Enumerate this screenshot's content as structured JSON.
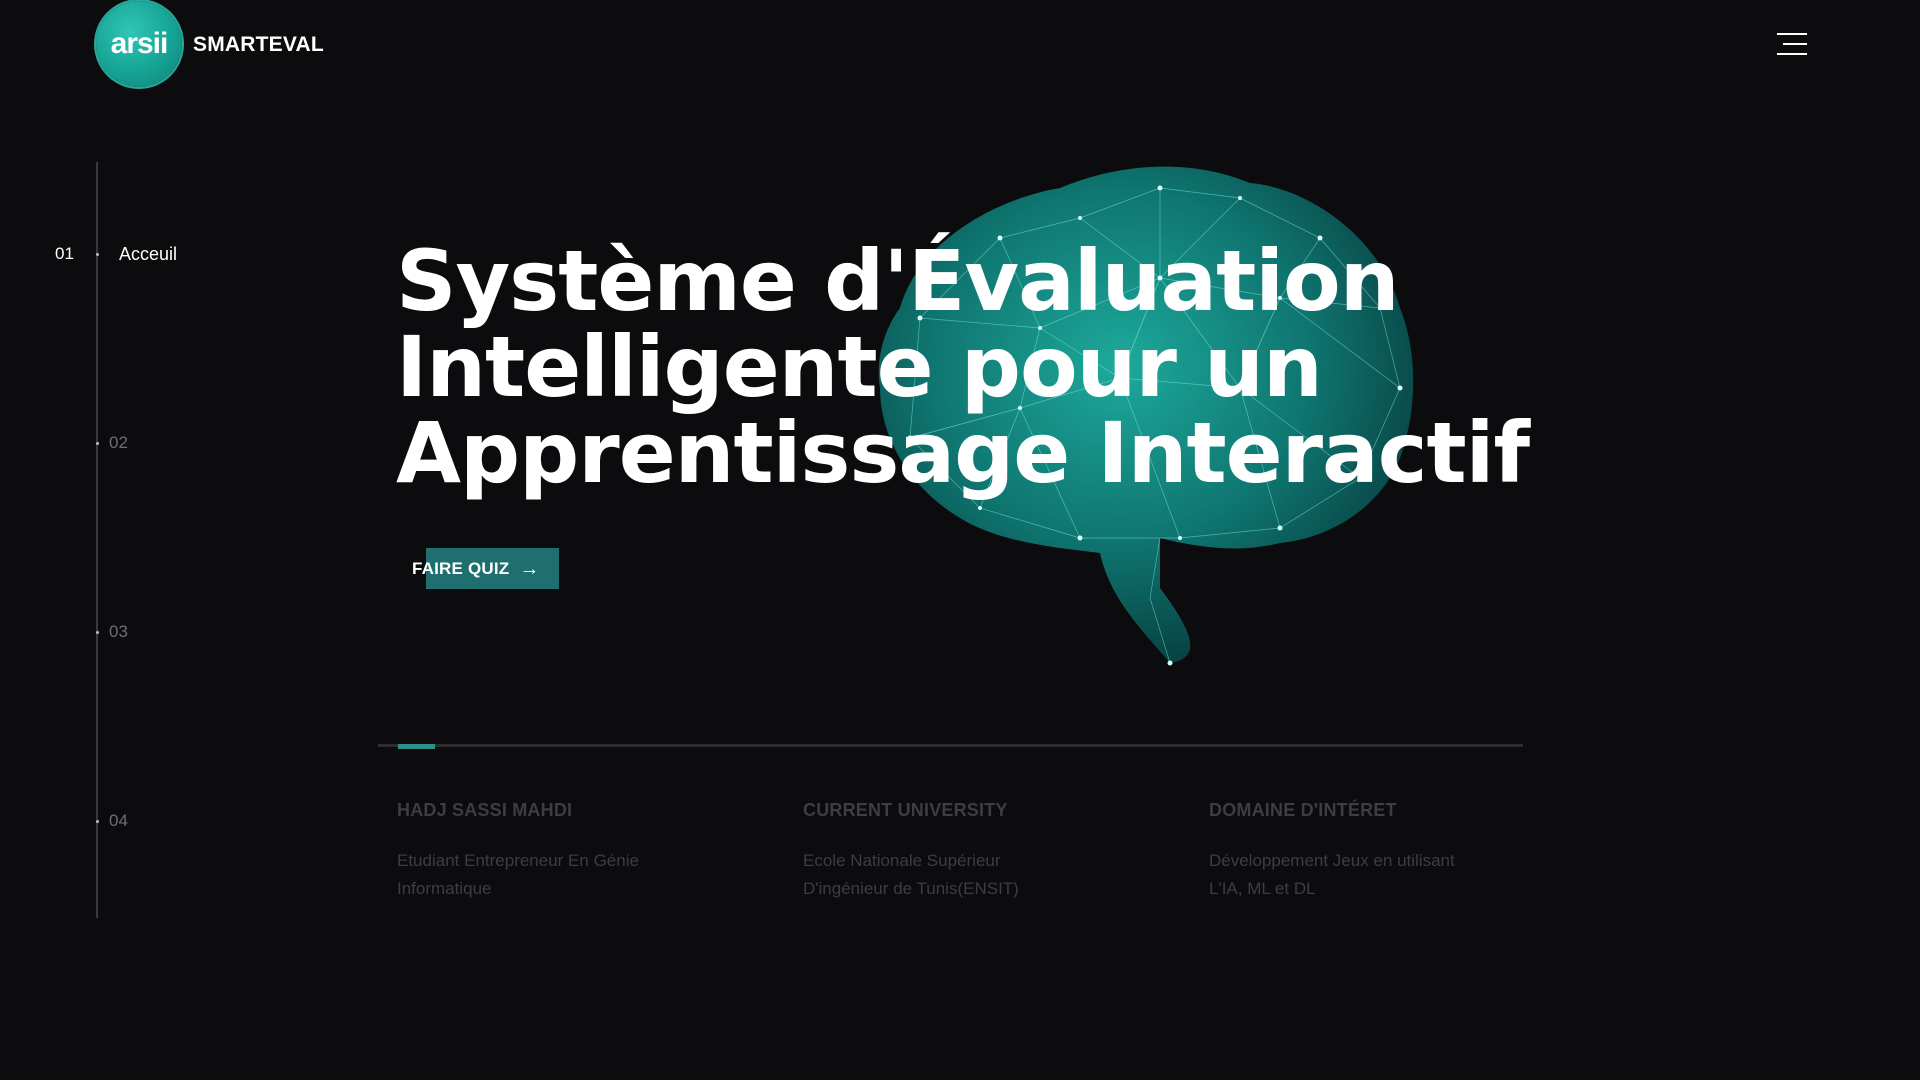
{
  "header": {
    "logo_text": "arsii",
    "brand": "SMARTEVAL",
    "menu_icon": "hamburger-menu-icon"
  },
  "side_nav": {
    "items": [
      {
        "number": "01",
        "label": "Acceuil",
        "active": true
      },
      {
        "number": "02",
        "label": "",
        "active": false
      },
      {
        "number": "03",
        "label": "",
        "active": false
      },
      {
        "number": "04",
        "label": "",
        "active": false
      }
    ]
  },
  "hero": {
    "title_line1": "Système d'Évaluation",
    "title_line2": "Intelligente pour un",
    "title_line3": "Apprentissage Interactif",
    "cta_label": "FAIRE QUIZ",
    "cta_icon": "arrow-right-icon",
    "image_icon": "brain-network-illustration",
    "progress": 0.03
  },
  "info": [
    {
      "heading": "HADJ SASSI MAHDI",
      "text_line1": "Etudiant Entrepreneur En Génie",
      "text_line2": "Informatique"
    },
    {
      "heading": "CURRENT UNIVERSITY",
      "text_line1": "Ecole Nationale Supérieur",
      "text_line2": "D'ingénieur de Tunis(ENSIT)"
    },
    {
      "heading": "DOMAINE D'INTÉRET",
      "text_line1": "Développement Jeux en utilisant",
      "text_line2": "L'IA, ML et DL"
    }
  ],
  "colors": {
    "background": "#0c0c0e",
    "accent": "#1f6e70",
    "logo": "#16a394"
  }
}
